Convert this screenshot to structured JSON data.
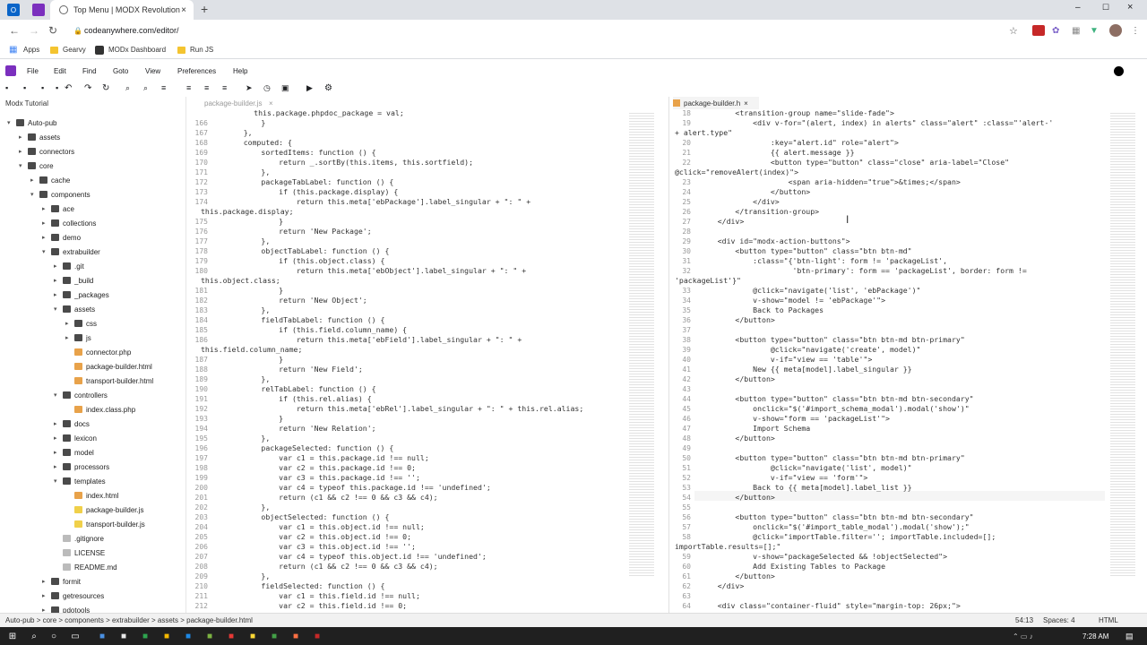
{
  "browser": {
    "tabs": [
      {
        "title": "Top Menu | MODX Revolution"
      }
    ],
    "url": "codeanywhere.com/editor/",
    "bookmarks": [
      "Apps",
      "Gearvy",
      "MODx Dashboard",
      "Run JS"
    ]
  },
  "ide": {
    "menu": [
      "File",
      "Edit",
      "Find",
      "Goto",
      "View",
      "Preferences",
      "Help"
    ],
    "project_title": "Modx Tutorial",
    "editor_tab_left": "package-builder.js",
    "editor_tab_right": "package-builder.h"
  },
  "tree": [
    {
      "label": "Auto-pub",
      "type": "folder",
      "level": 0,
      "open": true
    },
    {
      "label": "assets",
      "type": "folder",
      "level": 1,
      "open": false
    },
    {
      "label": "connectors",
      "type": "folder",
      "level": 1,
      "open": false
    },
    {
      "label": "core",
      "type": "folder",
      "level": 1,
      "open": true
    },
    {
      "label": "cache",
      "type": "folder",
      "level": 2,
      "open": false
    },
    {
      "label": "components",
      "type": "folder",
      "level": 2,
      "open": true
    },
    {
      "label": "ace",
      "type": "folder",
      "level": 3,
      "open": false
    },
    {
      "label": "collections",
      "type": "folder",
      "level": 3,
      "open": false
    },
    {
      "label": "demo",
      "type": "folder",
      "level": 3,
      "open": false
    },
    {
      "label": "extrabuilder",
      "type": "folder",
      "level": 3,
      "open": true
    },
    {
      "label": ".git",
      "type": "folder",
      "level": 4,
      "open": false
    },
    {
      "label": "_build",
      "type": "folder",
      "level": 4,
      "open": false
    },
    {
      "label": "_packages",
      "type": "folder",
      "level": 4,
      "open": false
    },
    {
      "label": "assets",
      "type": "folder",
      "level": 4,
      "open": true
    },
    {
      "label": "css",
      "type": "folder",
      "level": 5,
      "open": false
    },
    {
      "label": "js",
      "type": "folder",
      "level": 5,
      "open": false
    },
    {
      "label": "connector.php",
      "type": "php",
      "level": 5
    },
    {
      "label": "package-builder.html",
      "type": "html",
      "level": 5
    },
    {
      "label": "transport-builder.html",
      "type": "html",
      "level": 5
    },
    {
      "label": "controllers",
      "type": "folder",
      "level": 4,
      "open": true
    },
    {
      "label": "index.class.php",
      "type": "php",
      "level": 5
    },
    {
      "label": "docs",
      "type": "folder",
      "level": 4,
      "open": false
    },
    {
      "label": "lexicon",
      "type": "folder",
      "level": 4,
      "open": false
    },
    {
      "label": "model",
      "type": "folder",
      "level": 4,
      "open": false
    },
    {
      "label": "processors",
      "type": "folder",
      "level": 4,
      "open": false
    },
    {
      "label": "templates",
      "type": "folder",
      "level": 4,
      "open": true
    },
    {
      "label": "index.html",
      "type": "html",
      "level": 5
    },
    {
      "label": "package-builder.js",
      "type": "js",
      "level": 5
    },
    {
      "label": "transport-builder.js",
      "type": "js",
      "level": 5
    },
    {
      "label": ".gitignore",
      "type": "plain",
      "level": 4
    },
    {
      "label": "LICENSE",
      "type": "plain",
      "level": 4
    },
    {
      "label": "README.md",
      "type": "plain",
      "level": 4
    },
    {
      "label": "formit",
      "type": "folder",
      "level": 3,
      "open": false
    },
    {
      "label": "getresources",
      "type": "folder",
      "level": 3,
      "open": false
    },
    {
      "label": "pdotools",
      "type": "folder",
      "level": 3,
      "open": false
    }
  ],
  "left_code": [
    {
      "n": "",
      "t": "            this.package.phpdoc_package = val;"
    },
    {
      "n": "166",
      "t": "        }"
    },
    {
      "n": "167",
      "t": "    },"
    },
    {
      "n": "168",
      "t": "    computed: {"
    },
    {
      "n": "169",
      "t": "        sortedItems: function () {"
    },
    {
      "n": "170",
      "t": "            return _.sortBy(this.items, this.sortfield);"
    },
    {
      "n": "171",
      "t": "        },"
    },
    {
      "n": "172",
      "t": "        packageTabLabel: function () {"
    },
    {
      "n": "173",
      "t": "            if (this.package.display) {"
    },
    {
      "n": "174",
      "t": "                return this.meta['ebPackage'].label_singular + \": \" +"
    },
    {
      "n": "",
      "t": "this.package.display;"
    },
    {
      "n": "175",
      "t": "            }"
    },
    {
      "n": "176",
      "t": "            return 'New Package';"
    },
    {
      "n": "177",
      "t": "        },"
    },
    {
      "n": "178",
      "t": "        objectTabLabel: function () {"
    },
    {
      "n": "179",
      "t": "            if (this.object.class) {"
    },
    {
      "n": "180",
      "t": "                return this.meta['ebObject'].label_singular + \": \" +"
    },
    {
      "n": "",
      "t": "this.object.class;"
    },
    {
      "n": "181",
      "t": "            }"
    },
    {
      "n": "182",
      "t": "            return 'New Object';"
    },
    {
      "n": "183",
      "t": "        },"
    },
    {
      "n": "184",
      "t": "        fieldTabLabel: function () {"
    },
    {
      "n": "185",
      "t": "            if (this.field.column_name) {"
    },
    {
      "n": "186",
      "t": "                return this.meta['ebField'].label_singular + \": \" +"
    },
    {
      "n": "",
      "t": "this.field.column_name;"
    },
    {
      "n": "187",
      "t": "            }"
    },
    {
      "n": "188",
      "t": "            return 'New Field';"
    },
    {
      "n": "189",
      "t": "        },"
    },
    {
      "n": "190",
      "t": "        relTabLabel: function () {"
    },
    {
      "n": "191",
      "t": "            if (this.rel.alias) {"
    },
    {
      "n": "192",
      "t": "                return this.meta['ebRel'].label_singular + \": \" + this.rel.alias;"
    },
    {
      "n": "193",
      "t": "            }"
    },
    {
      "n": "194",
      "t": "            return 'New Relation';"
    },
    {
      "n": "195",
      "t": "        },"
    },
    {
      "n": "196",
      "t": "        packageSelected: function () {"
    },
    {
      "n": "197",
      "t": "            var c1 = this.package.id !== null;"
    },
    {
      "n": "198",
      "t": "            var c2 = this.package.id !== 0;"
    },
    {
      "n": "199",
      "t": "            var c3 = this.package.id !== '';"
    },
    {
      "n": "200",
      "t": "            var c4 = typeof this.package.id !== 'undefined';"
    },
    {
      "n": "201",
      "t": "            return (c1 && c2 !== 0 && c3 && c4);"
    },
    {
      "n": "202",
      "t": "        },"
    },
    {
      "n": "203",
      "t": "        objectSelected: function () {"
    },
    {
      "n": "204",
      "t": "            var c1 = this.object.id !== null;"
    },
    {
      "n": "205",
      "t": "            var c2 = this.object.id !== 0;"
    },
    {
      "n": "206",
      "t": "            var c3 = this.object.id !== '';"
    },
    {
      "n": "207",
      "t": "            var c4 = typeof this.object.id !== 'undefined';"
    },
    {
      "n": "208",
      "t": "            return (c1 && c2 !== 0 && c3 && c4);"
    },
    {
      "n": "209",
      "t": "        },"
    },
    {
      "n": "210",
      "t": "        fieldSelected: function () {"
    },
    {
      "n": "211",
      "t": "            var c1 = this.field.id !== null;"
    },
    {
      "n": "212",
      "t": "            var c2 = this.field.id !== 0;"
    }
  ],
  "right_code": [
    {
      "n": "18",
      "t": "        <transition-group name=\"slide-fade\">"
    },
    {
      "n": "19",
      "t": "            <div v-for=\"(alert, index) in alerts\" class=\"alert\" :class=\"'alert-'"
    },
    {
      "n": "",
      "t": "+ alert.type\""
    },
    {
      "n": "20",
      "t": "                :key=\"alert.id\" role=\"alert\">"
    },
    {
      "n": "21",
      "t": "                {{ alert.message }}"
    },
    {
      "n": "22",
      "t": "                <button type=\"button\" class=\"close\" aria-label=\"Close\""
    },
    {
      "n": "",
      "t": "@click=\"removeAlert(index)\">"
    },
    {
      "n": "23",
      "t": "                    <span aria-hidden=\"true\">&times;</span>"
    },
    {
      "n": "24",
      "t": "                </button>"
    },
    {
      "n": "25",
      "t": "            </div>"
    },
    {
      "n": "26",
      "t": "        </transition-group>"
    },
    {
      "n": "27",
      "t": "    </div>"
    },
    {
      "n": "28",
      "t": ""
    },
    {
      "n": "29",
      "t": "    <div id=\"modx-action-buttons\">"
    },
    {
      "n": "30",
      "t": "        <button type=\"button\" class=\"btn btn-md\""
    },
    {
      "n": "31",
      "t": "            :class=\"{'btn-light': form != 'packageList',"
    },
    {
      "n": "32",
      "t": "                     'btn-primary': form == 'packageList', border: form !="
    },
    {
      "n": "",
      "t": "'packageList'}\""
    },
    {
      "n": "33",
      "t": "            @click=\"navigate('list', 'ebPackage')\""
    },
    {
      "n": "34",
      "t": "            v-show=\"model != 'ebPackage'\">"
    },
    {
      "n": "35",
      "t": "            Back to Packages"
    },
    {
      "n": "36",
      "t": "        </button>"
    },
    {
      "n": "37",
      "t": ""
    },
    {
      "n": "38",
      "t": "        <button type=\"button\" class=\"btn btn-md btn-primary\""
    },
    {
      "n": "39",
      "t": "                @click=\"navigate('create', model)\""
    },
    {
      "n": "40",
      "t": "                v-if=\"view == 'table'\">"
    },
    {
      "n": "41",
      "t": "            New {{ meta[model].label_singular }}"
    },
    {
      "n": "42",
      "t": "        </button>"
    },
    {
      "n": "43",
      "t": ""
    },
    {
      "n": "44",
      "t": "        <button type=\"button\" class=\"btn btn-md btn-secondary\""
    },
    {
      "n": "45",
      "t": "            onclick=\"$('#import_schema_modal').modal('show')\""
    },
    {
      "n": "46",
      "t": "            v-show=\"form == 'packageList'\">"
    },
    {
      "n": "47",
      "t": "            Import Schema"
    },
    {
      "n": "48",
      "t": "        </button>"
    },
    {
      "n": "49",
      "t": ""
    },
    {
      "n": "50",
      "t": "        <button type=\"button\" class=\"btn btn-md btn-primary\""
    },
    {
      "n": "51",
      "t": "                @click=\"navigate('list', model)\""
    },
    {
      "n": "52",
      "t": "                v-if=\"view == 'form'\">"
    },
    {
      "n": "53",
      "t": "            Back to {{ meta[model].label_list }}"
    },
    {
      "n": "54",
      "t": "        </button>"
    },
    {
      "n": "55",
      "t": ""
    },
    {
      "n": "56",
      "t": "        <button type=\"button\" class=\"btn btn-md btn-secondary\""
    },
    {
      "n": "57",
      "t": "            onclick=\"$('#import_table_modal').modal('show');\""
    },
    {
      "n": "58",
      "t": "            @click=\"importTable.filter=''; importTable.included=[];"
    },
    {
      "n": "",
      "t": "importTable.results=[];\""
    },
    {
      "n": "59",
      "t": "            v-show=\"packageSelected && !objectSelected\">"
    },
    {
      "n": "60",
      "t": "            Add Existing Tables to Package"
    },
    {
      "n": "61",
      "t": "        </button>"
    },
    {
      "n": "62",
      "t": "    </div>"
    },
    {
      "n": "63",
      "t": ""
    },
    {
      "n": "64",
      "t": "    <div class=\"container-fluid\" style=\"margin-top: 26px;\">"
    }
  ],
  "status": {
    "path": "Auto-pub > core > components > extrabuilder > assets > package-builder.html",
    "cursor": "54:13",
    "spaces": "Spaces: 4",
    "mode": "HTML"
  },
  "taskbar": {
    "time": "7:28 AM"
  },
  "colors": {
    "accent": "#7b2fbe",
    "keyword": "#1a1aa6",
    "string": "#a31515"
  }
}
